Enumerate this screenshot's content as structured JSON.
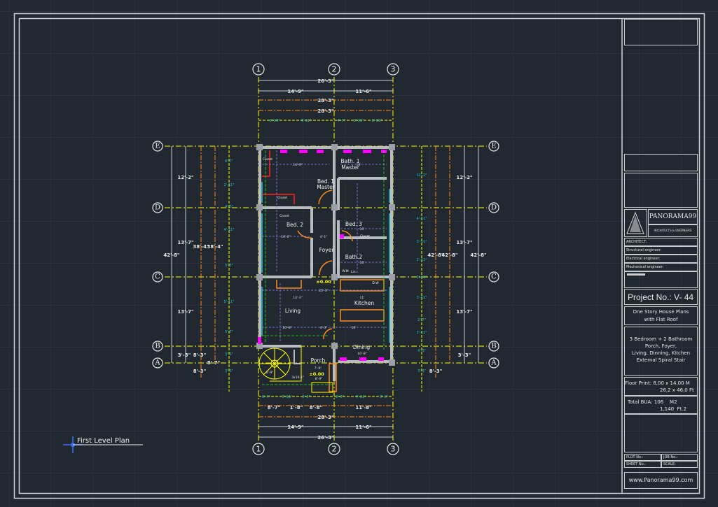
{
  "plan_title": "First Level Plan",
  "grid": {
    "columns": [
      "1",
      "2",
      "3"
    ],
    "rows": [
      "E",
      "D",
      "C",
      "B",
      "A"
    ]
  },
  "dims_top": {
    "overall": "26'-3\"",
    "col12": "14'-9\"",
    "col23": "11'-6\"",
    "orange1": "28'-3\"",
    "orange2": "28'-3\"",
    "openings": [
      "3'-10\"",
      "4'-11\"",
      "4'-7\"",
      "2'-11\"",
      "3'-11\""
    ]
  },
  "dims_bottom": {
    "openings": [
      "6'-7\"",
      "3'-11\"",
      "3'-3\"",
      "3'-3\"",
      "4'-11\"",
      "3'-3\""
    ],
    "segments": [
      "8'-7\"",
      "1'-8\"",
      "8'-8\"",
      "11'-8\""
    ],
    "orange": "28'-3\"",
    "col12": "14'-9\"",
    "col23": "11'-6\"",
    "overall": "26'-3\""
  },
  "dims_left": {
    "ed": "12'-2\"",
    "dc": "13'-7\"",
    "cb": "13'-7\"",
    "ba": "3'-3\"",
    "overall": "42'-8\"",
    "orange1": "38'-4\"",
    "orange2": "38'-4\"",
    "porch1": "8'-3\"",
    "porch2": "8'-3\"",
    "porch3": "8'-7\"",
    "openings": [
      "6'-7\"",
      "2'-11\"",
      "4'-5\"",
      "4'-11\"",
      "5'-5\"",
      "5'-11\"",
      "5'-7\"",
      "3'-3\"",
      "3'-3\""
    ]
  },
  "dims_right": {
    "ed": "12'-2\"",
    "dc": "13'-7\"",
    "cb": "13'-7\"",
    "ba": "3'-3\"",
    "overall": "42'-8\"",
    "orange1": "42'-8\"",
    "orange2": "42'-8\"",
    "bottom": "8'-3\"",
    "openings": [
      "12'-2\"",
      "4'-11\"",
      "3'-11\"",
      "2'-11\"",
      "3'-11\"",
      "3'-11\"",
      "2'-7\"",
      "3'-11\"",
      "4'-3\"",
      "3'-3\""
    ]
  },
  "rooms": {
    "bath1": "Bath. 1",
    "bath1_sub": "Master",
    "bed1": "Bed. 1",
    "bed1_sub": "Master",
    "bed2": "Bed. 2",
    "bed3": "Bed. 3",
    "foyer": "Foyer",
    "bath2": "Bath.2",
    "wm": "W.M",
    "lin": "Lin.",
    "living": "Living",
    "kitchen": "Kitchen",
    "dining": "Dining",
    "porch": "Porch",
    "dw": "D.W",
    "closet": "Closet",
    "level1": "±0.00",
    "level2": "±0.00",
    "stair_note": "3x16.5\""
  },
  "interior_dims": [
    "14'-9\"",
    "10'",
    "10'-2\"",
    "4'-1\"",
    "10'",
    "10'",
    "25'-3\"",
    "14'-3\"",
    "11'",
    "10'-8\"",
    "4'-3\"",
    "10'",
    "10'-8\"",
    "7'-9\"",
    "6'-9\"",
    "8'-9\""
  ],
  "title_block": {
    "firm_name": "PANORAMA99",
    "firm_tagline": "ARCHITECTS & ENGINEERS",
    "architect": "ARCHITECT:",
    "structural": "Structural engineer:",
    "electrical": "Electrical engineer:",
    "mechanical": "Mechanical engineer:",
    "project_no": "Project No.: V- 44",
    "project_title_1": "One Story House Plans",
    "project_title_2": "with Flat Roof",
    "desc_1": "3 Bedroom + 2 Bathroom",
    "desc_2": "Porch, Foyer,",
    "desc_3": "Living, Dinning, Kitchen",
    "desc_4": "External Spiral Stair",
    "floor_print_label": "Floor Print:",
    "floor_print_m": "8,00 x 14,00 M",
    "floor_print_ft": "26,2 x 46,0 Ft",
    "bua_label": "Total BUA:",
    "bua_m": "106    M2",
    "bua_ft": "1,140  Ft.2",
    "plot_no": "PLOT No.:",
    "job_no": "JOB No.:",
    "sheet_no": "SHEET No.:",
    "scale": "SCALE:",
    "website": "www.Panorama99.com"
  },
  "colors": {
    "background": "#212830",
    "grid_line": "#ffff00",
    "wall": "#b8bcc0",
    "dim_orange": "#ff8c1a",
    "dim_cyan": "#20c8d0",
    "dim_purple": "#9a80ff",
    "dim_green": "#20e020",
    "window_magenta": "#ff00ff",
    "closet_red": "#ff2020",
    "frame": "#d0d4d8"
  }
}
